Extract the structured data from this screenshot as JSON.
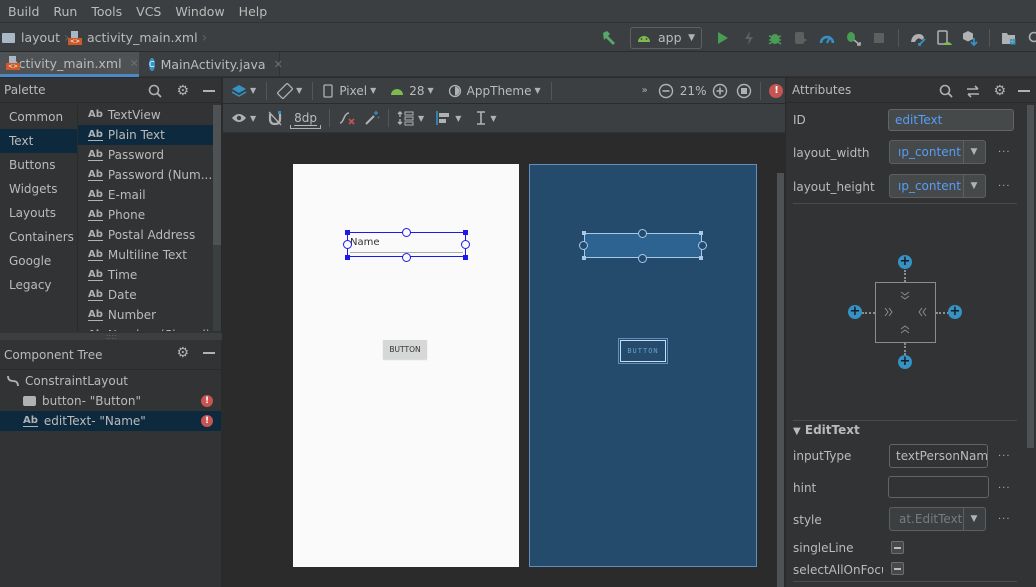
{
  "menu": [
    "Build",
    "Run",
    "Tools",
    "VCS",
    "Window",
    "Help"
  ],
  "breadcrumb": {
    "folder": "layout",
    "file": "activity_main.xml"
  },
  "run_config": {
    "label": "app"
  },
  "tabs": [
    {
      "label": "activity_main.xml",
      "active": true
    },
    {
      "label": "MainActivity.java",
      "active": false
    }
  ],
  "palette": {
    "title": "Palette",
    "categories": [
      "Common",
      "Text",
      "Buttons",
      "Widgets",
      "Layouts",
      "Containers",
      "Google",
      "Legacy"
    ],
    "selected_category": "Text",
    "items": [
      "TextView",
      "Plain Text",
      "Password",
      "Password (Num...",
      "E-mail",
      "Phone",
      "Postal Address",
      "Multiline Text",
      "Time",
      "Date",
      "Number",
      "Number (Signed)"
    ],
    "selected_item": "Plain Text"
  },
  "component_tree": {
    "title": "Component Tree",
    "root": "ConstraintLayout",
    "children": [
      {
        "label": "button- \"Button\"",
        "icon": "button-icon",
        "error": true
      },
      {
        "label": "editText- \"Name\"",
        "icon": "textfield-icon",
        "error": true,
        "selected": true
      }
    ]
  },
  "design_toolbar": {
    "device": "Pixel",
    "api": "28",
    "theme": "AppTheme",
    "zoom": "21%",
    "margin": "8dp"
  },
  "design": {
    "edittext_text": "Name",
    "button_text": "BUTTON"
  },
  "attributes": {
    "title": "Attributes",
    "id_label": "ID",
    "id_value": "editText",
    "layout_width_label": "layout_width",
    "layout_width_value": "ıp_content",
    "layout_height_label": "layout_height",
    "layout_height_value": "ıp_content",
    "section": "EditText",
    "input_type_label": "inputType",
    "input_type_value": "textPersonName",
    "hint_label": "hint",
    "hint_value": "",
    "style_label": "style",
    "style_value": "at.EditText",
    "single_line_label": "singleLine",
    "select_all_label": "selectAllOnFocus",
    "ellipsis": "..."
  },
  "colors": {
    "accent": "#4a88c7",
    "selection_blue": "#1a1aef",
    "blueprint": "#244b6b",
    "error": "#c75450",
    "link": "#589df6"
  }
}
